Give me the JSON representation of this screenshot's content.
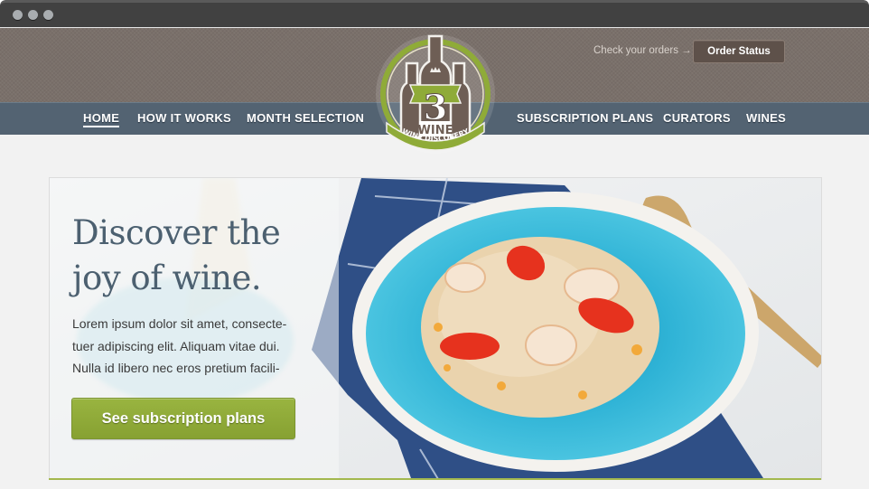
{
  "window": {
    "controls": [
      "close",
      "minimize",
      "maximize"
    ]
  },
  "header": {
    "orders_prompt": "Check your orders →",
    "order_status_label": "Order Status"
  },
  "logo": {
    "number": "3",
    "word": "WINE",
    "tagline": "WINE DISCOVERY",
    "icon": "crown-icon"
  },
  "nav": {
    "items": [
      {
        "label": "HOME",
        "active": true
      },
      {
        "label": "HOW IT WORKS",
        "active": false
      },
      {
        "label": "MONTH SELECTION",
        "active": false
      },
      {
        "label": "SUBSCRIPTION PLANS",
        "active": false
      },
      {
        "label": "CURATORS",
        "active": false
      },
      {
        "label": "WINES",
        "active": false
      }
    ]
  },
  "hero": {
    "title_line1": "Discover the",
    "title_line2": "joy of wine.",
    "body_line1": "Lorem ipsum dolor sit amet, consecte-",
    "body_line2": "tuer adipiscing elit. Aliquam vitae dui.",
    "body_line3": "Nulla id libero nec eros pretium facili-",
    "cta_label": "See subscription plans",
    "image": "couscous-shrimp-plate-photo"
  },
  "colors": {
    "header_brown": "#7a706a",
    "nav_slate": "#536372",
    "accent_green": "#8fab38",
    "title_slate": "#4c6070",
    "plate_blue": "#2fb3d6"
  }
}
